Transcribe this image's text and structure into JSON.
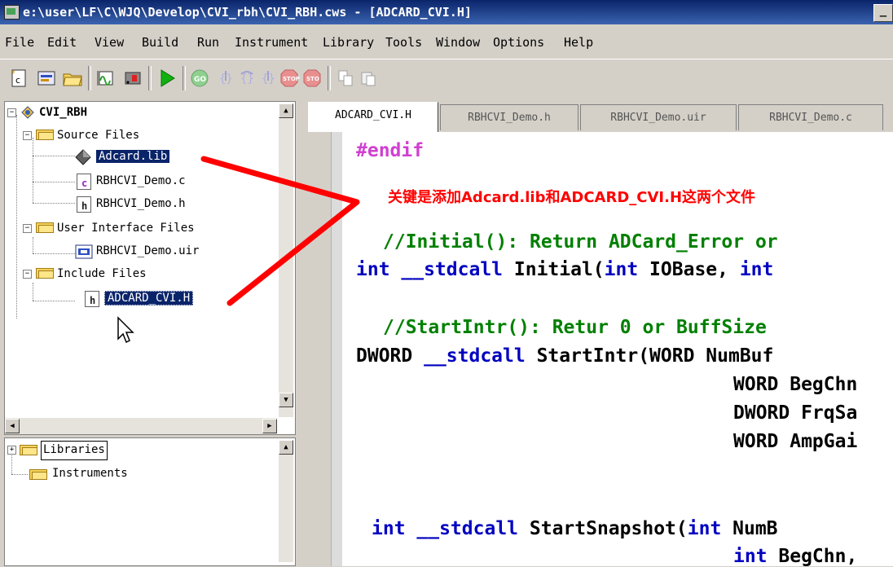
{
  "window": {
    "title": "e:\\user\\LF\\C\\WJQ\\Develop\\CVI_rbh\\CVI_RBH.cws - [ADCARD_CVI.H]",
    "minimize_label": "_"
  },
  "menu": {
    "items": [
      "File",
      "Edit",
      "View",
      "Build",
      "Run",
      "Instrument",
      "Library",
      "Tools",
      "Window",
      "Options",
      "Help"
    ]
  },
  "toolbar": {
    "icons": [
      "new-c-icon",
      "open-project-icon",
      "open-folder-icon",
      "wave-icon",
      "chart-icon",
      "run-icon",
      "go-icon",
      "step-into-icon",
      "step-over-icon",
      "step-out-icon",
      "stop-icon",
      "stop-icon-2",
      "copy-icon",
      "paste-icon"
    ]
  },
  "project_tree": {
    "root": "CVI_RBH",
    "source_files_label": "Source Files",
    "source_files": [
      "Adcard.lib",
      "RBHCVI_Demo.c",
      "RBHCVI_Demo.h"
    ],
    "ui_files_label": "User Interface Files",
    "ui_files": [
      "RBHCVI_Demo.uir"
    ],
    "include_files_label": "Include Files",
    "include_files": [
      "ADCARD_CVI.H"
    ]
  },
  "lib_tree": {
    "libraries_label": "Libraries",
    "instruments_label": "Instruments"
  },
  "tabs": [
    "ADCARD_CVI.H",
    "RBHCVI_Demo.h",
    "RBHCVI_Demo.uir",
    "RBHCVI_Demo.c"
  ],
  "code": {
    "l1": "#endif",
    "l2_comment": "//Initial(): Return ADCard_Error or",
    "l3_a": "int",
    "l3_b": " __stdcall",
    "l3_c": " Initial(",
    "l3_d": "int",
    "l3_e": " IOBase, ",
    "l3_f": "int",
    "l4_comment": "//StartIntr(): Retur 0 or BuffSize",
    "l5_a": "DWORD ",
    "l5_b": "__stdcall",
    "l5_c": " StartIntr(WORD NumBuf",
    "l6": "WORD BegChn",
    "l7": "DWORD FrqSa",
    "l8": "WORD AmpGai",
    "l9_a": "int",
    "l9_b": " __stdcall",
    "l9_c": " StartSnapshot(",
    "l9_d": "int",
    "l9_e": " NumB",
    "l10_a": "int",
    "l10_b": " BegChn,"
  },
  "annotation": "关键是添加Adcard.lib和ADCARD_CVI.H这两个文件",
  "colors": {
    "annotation": "#ff0000",
    "keyword": "#0000c0",
    "comment": "#008000",
    "preprocessor": "#d040d0",
    "selection": "#0a246a"
  }
}
